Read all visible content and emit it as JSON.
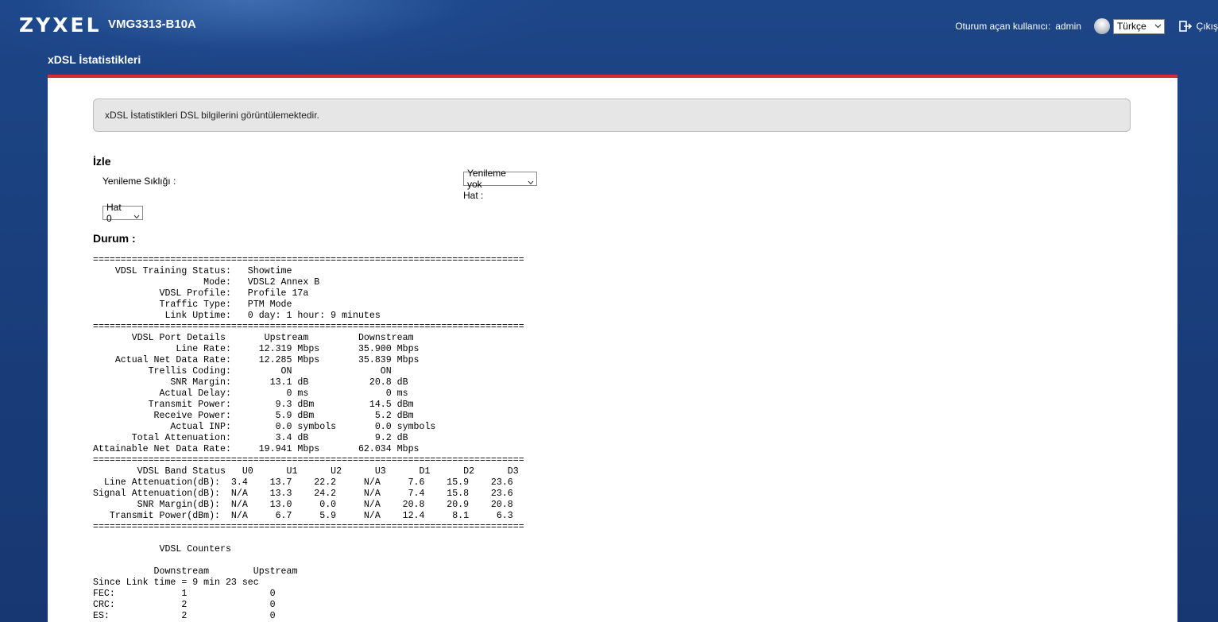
{
  "header": {
    "brand": "ZYXEL",
    "model": "VMG3313-B10A",
    "user_label": "Oturum açan kullanıcı:",
    "user_name": "admin",
    "language": "Türkçe",
    "logout_label": "Çıkış"
  },
  "page": {
    "title": "xDSL İstatistikleri",
    "info": "xDSL İstatistikleri DSL bilgilerini görüntülemektedir."
  },
  "monitor": {
    "title": "İzle",
    "refresh_label": "Yenileme Sıklığı :",
    "refresh_value": "Yenileme yok",
    "line_label": "Hat :",
    "line_value": "Hat 0"
  },
  "status": {
    "title": "Durum :",
    "text": "==============================================================================\n    VDSL Training Status:   Showtime\n                    Mode:   VDSL2 Annex B\n            VDSL Profile:   Profile 17a\n            Traffic Type:   PTM Mode\n             Link Uptime:   0 day: 1 hour: 9 minutes\n==============================================================================\n       VDSL Port Details       Upstream         Downstream\n               Line Rate:     12.319 Mbps       35.900 Mbps\n    Actual Net Data Rate:     12.285 Mbps       35.839 Mbps\n          Trellis Coding:         ON                ON\n              SNR Margin:       13.1 dB           20.8 dB\n            Actual Delay:          0 ms              0 ms\n          Transmit Power:        9.3 dBm          14.5 dBm\n           Receive Power:        5.9 dBm           5.2 dBm\n              Actual INP:        0.0 symbols       0.0 symbols\n       Total Attenuation:        3.4 dB            9.2 dB\nAttainable Net Data Rate:     19.941 Mbps       62.034 Mbps\n==============================================================================\n        VDSL Band Status   U0      U1      U2      U3      D1      D2      D3\n  Line Attenuation(dB):  3.4    13.7    22.2     N/A     7.6    15.9    23.6\nSignal Attenuation(dB):  N/A    13.3    24.2     N/A     7.4    15.8    23.6\n        SNR Margin(dB):  N/A    13.0     0.0     N/A    20.8    20.9    20.8\n   Transmit Power(dBm):  N/A     6.7     5.9     N/A    12.4     8.1     6.3\n==============================================================================\n\n            VDSL Counters\n\n           Downstream        Upstream\nSince Link time = 9 min 23 sec\nFEC:            1               0\nCRC:            2               0\nES:             2               0"
  }
}
